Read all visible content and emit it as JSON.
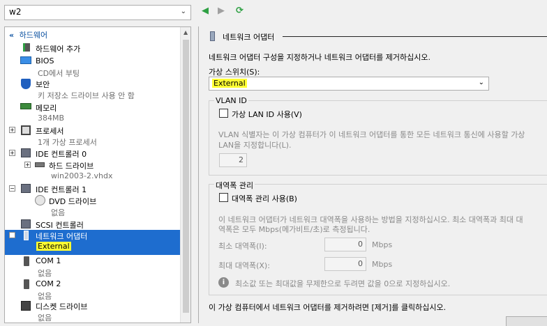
{
  "vm_selector": {
    "value": "w2"
  },
  "toolbar": {
    "back": "◀",
    "forward": "▶",
    "refresh": "⟳"
  },
  "tree": {
    "section": "하드웨어",
    "items": [
      {
        "label": "하드웨어 추가",
        "sub": ""
      },
      {
        "label": "BIOS",
        "sub": "CD에서 부팅"
      },
      {
        "label": "보안",
        "sub": "키 저장소 드라이브 사용 안 함"
      },
      {
        "label": "메모리",
        "sub": "384MB"
      },
      {
        "label": "프로세서",
        "sub": "1개 가상 프로세서"
      },
      {
        "label": "IDE 컨트롤러 0",
        "sub": ""
      },
      {
        "label": "하드 드라이브",
        "sub": "win2003-2.vhdx"
      },
      {
        "label": "IDE 컨트롤러 1",
        "sub": ""
      },
      {
        "label": "DVD 드라이브",
        "sub": "없음"
      },
      {
        "label": "SCSI 컨트롤러",
        "sub": ""
      },
      {
        "label": "네트워크 어댑터",
        "sub": "External"
      },
      {
        "label": "COM 1",
        "sub": "없음"
      },
      {
        "label": "COM 2",
        "sub": "없음"
      },
      {
        "label": "디스켓 드라이브",
        "sub": "없음"
      }
    ]
  },
  "panel": {
    "title": "네트워크 어댑터",
    "description": "네트워크 어댑터 구성을 지정하거나 네트워크 어댑터를 제거하십시오.",
    "switch_label": "가상 스위치(S):",
    "switch_value": "External",
    "vlan_group": "VLAN ID",
    "vlan_checkbox": "가상 LAN ID 사용(V)",
    "vlan_desc_1": "VLAN 식별자는 이 가상 컴퓨터가 이 네트워크 어댑터를 통한 모든 네트워크 통신에 사용할 가상",
    "vlan_desc_2": "LAN을 지정합니다(L).",
    "vlan_value": "2",
    "bw_group": "대역폭 관리",
    "bw_checkbox": "대역폭 관리 사용(B)",
    "bw_desc_1": "이 네트워크 어댑터가 네트워크 대역폭을 사용하는 방법을 지정하십시오. 최소 대역폭과 최대 대",
    "bw_desc_2": "역폭은 모두 Mbps(메가비트/초)로 측정됩니다.",
    "min_label": "최소 대역폭(I):",
    "min_value": "0",
    "max_label": "최대 대역폭(X):",
    "max_value": "0",
    "unit": "Mbps",
    "info": "최소값 또는 최대값을 무제한으로 두려면 값을 0으로 지정하십시오.",
    "remove_text": "이 가상 컴퓨터에서 네트워크 어댑터를 제거하려면 [제거]를 클릭하십시오."
  },
  "colors": {
    "selection": "#1e6dcf",
    "highlight": "#ffff33",
    "nav_green": "#2ea043"
  }
}
